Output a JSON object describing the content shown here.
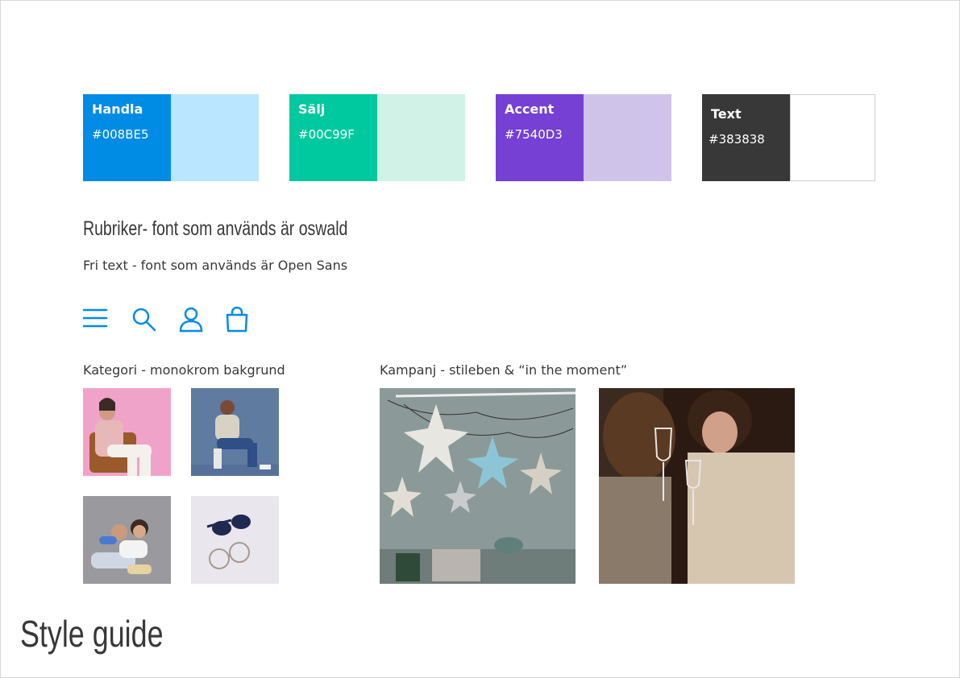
{
  "swatches": [
    {
      "name": "Handla",
      "hex": "#008BE5",
      "color": "#008BE5",
      "tint": "#BAE6FF"
    },
    {
      "name": "Sälj",
      "hex": "#00C99F",
      "color": "#00C99F",
      "tint": "#D1F2E6"
    },
    {
      "name": "Accent",
      "hex": "#7540D3",
      "color": "#7540D3",
      "tint": "#D0C3E9"
    },
    {
      "name": "Text",
      "hex": "#383838",
      "color": "#383838",
      "tint": "#FFFFFF"
    }
  ],
  "typography": {
    "heading_sample": "Rubriker- font som används är oswald",
    "body_sample": "Fri text - font som används är Open Sans"
  },
  "icons": [
    "menu-icon",
    "search-icon",
    "user-icon",
    "shopping-bag-icon"
  ],
  "icon_color": "#008BE5",
  "category": {
    "caption": "Kategori - monokrom bakgrund",
    "images": [
      "woman-on-pink-background",
      "man-on-blue-background",
      "children-on-grey-background",
      "sunglasses-on-light-background"
    ]
  },
  "campaign": {
    "caption": "Kampanj - stileben & “in the moment”",
    "images": [
      "paper-stars-still-life",
      "women-toasting-wine"
    ]
  },
  "page_title": "Style guide"
}
